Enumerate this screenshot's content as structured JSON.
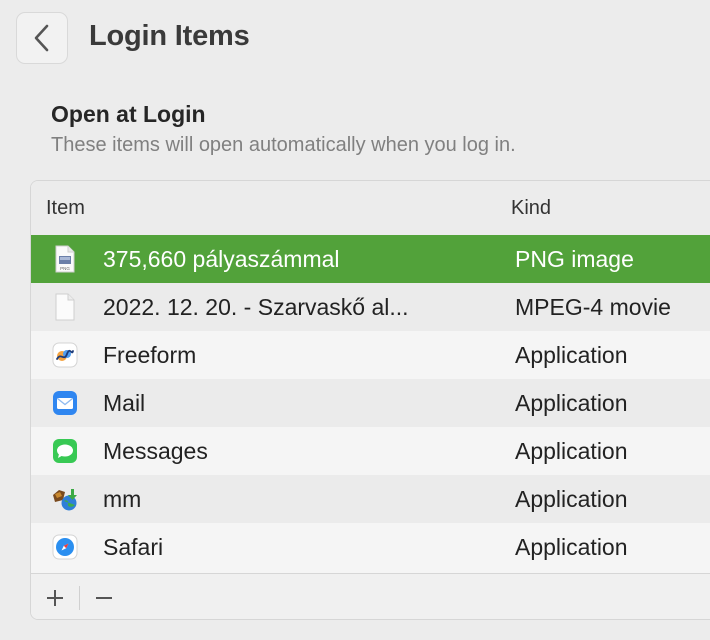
{
  "window": {
    "title": "Login Items"
  },
  "section": {
    "title": "Open at Login",
    "description": "These items will open automatically when you log in."
  },
  "table": {
    "columns": {
      "item": "Item",
      "kind": "Kind"
    },
    "rows": [
      {
        "name": "375,660 pályaszámmal",
        "kind": "PNG image",
        "icon": "png-file-icon",
        "selected": true
      },
      {
        "name": "2022. 12. 20. - Szarvaskő al...",
        "kind": "MPEG-4 movie",
        "icon": "document-file-icon",
        "selected": false
      },
      {
        "name": "Freeform",
        "kind": "Application",
        "icon": "freeform-app-icon",
        "selected": false
      },
      {
        "name": "Mail",
        "kind": "Application",
        "icon": "mail-app-icon",
        "selected": false
      },
      {
        "name": "Messages",
        "kind": "Application",
        "icon": "messages-app-icon",
        "selected": false
      },
      {
        "name": "mm",
        "kind": "Application",
        "icon": "mm-app-icon",
        "selected": false
      },
      {
        "name": "Safari",
        "kind": "Application",
        "icon": "safari-app-icon",
        "selected": false
      }
    ]
  },
  "footer": {
    "add_label": "+",
    "remove_label": "−"
  },
  "colors": {
    "selection": "#52a23a",
    "background": "#ececec"
  }
}
